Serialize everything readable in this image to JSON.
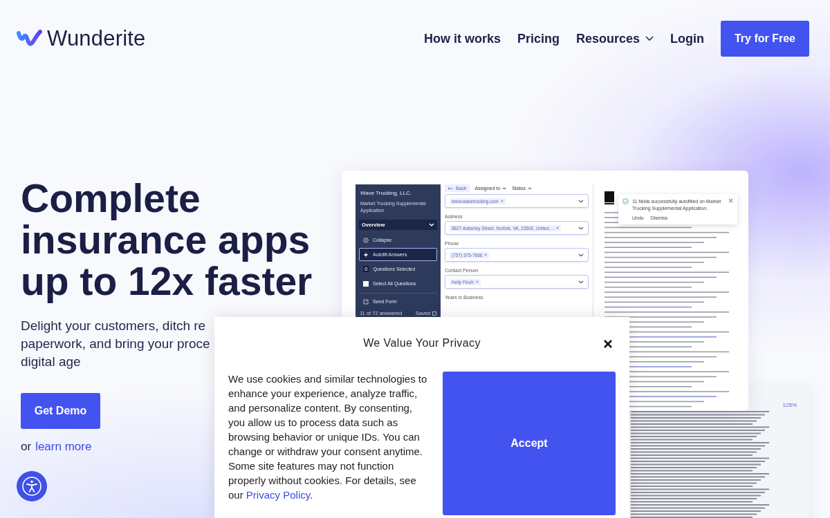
{
  "nav": {
    "logo": "Wunderite",
    "links": [
      {
        "label": "How it works",
        "dropdown": false
      },
      {
        "label": "Pricing",
        "dropdown": false
      },
      {
        "label": "Resources",
        "dropdown": true
      },
      {
        "label": "Login",
        "dropdown": false
      }
    ],
    "cta": "Try for Free"
  },
  "hero": {
    "title": "Complete insurance apps up to 12x faster",
    "lines": [
      "Delight your customers, ditch re",
      "paperwork, and bring your proce",
      "digital age"
    ],
    "button": "Get Demo",
    "or": "or",
    "link": "learn more"
  },
  "mockup": {
    "sidebar": {
      "company": "Wave Trucking, LLC.",
      "form_name": "Market Trucking Supplemental Application",
      "section": "Overview",
      "items": [
        {
          "kind": "collapse",
          "label": "Collapse",
          "selected": false
        },
        {
          "kind": "autofill",
          "label": "Autofill Answers",
          "selected": true
        },
        {
          "kind": "count",
          "badge": "0",
          "label": "Questions Selected",
          "selected": false
        },
        {
          "kind": "checkbox",
          "label": "Select All Questions",
          "checked": false,
          "selected": false
        },
        {
          "kind": "send",
          "label": "Send Form",
          "selected": false
        }
      ],
      "answered": "11 of 72 answered",
      "saved": "Saved"
    },
    "toolbar": {
      "back": "Back",
      "filters": [
        "Assigned to",
        "Status"
      ]
    },
    "fields": [
      {
        "chips": [
          "www.wavetrucking.com"
        ]
      },
      {
        "label": "Address",
        "chips": [
          "5827 Adderley Street, Norfolk, VA, 23502, United ..."
        ]
      },
      {
        "label": "Phone",
        "chips": [
          "(757) 375-7666"
        ]
      },
      {
        "label": "Contact Person",
        "chips": [
          "Kelly Finch"
        ]
      },
      {
        "label": "Years in Business"
      }
    ],
    "toast": {
      "message": "11 fields successfully autofilled on Market Trucking Supplemental Application.",
      "actions": [
        "Undo",
        "Dismiss"
      ]
    }
  },
  "second_card": {
    "zoom": "125%"
  },
  "cookie": {
    "title": "We Value Your Privacy",
    "body": "We use cookies and similar technologies to enhance your experience, analyze traffic, and personalize content. By consenting, you allow us to process data such as browsing behavior or unique IDs. You can change or withdraw your consent anytime. Some site features may not function properly without cookies. For details, see our ",
    "link": "Privacy Policy",
    "end": ".",
    "accept": "Accept"
  }
}
